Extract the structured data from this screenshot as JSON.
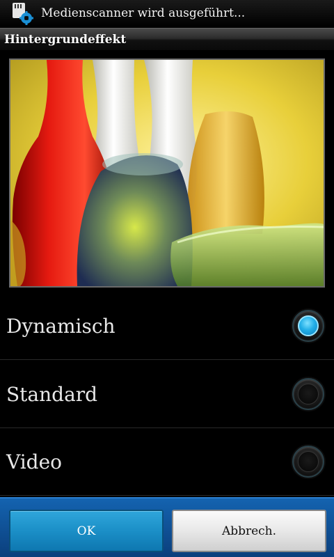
{
  "status_bar": {
    "notification_text": "Medienscanner wird ausgeführt...",
    "icon": "media-scanner-icon"
  },
  "dialog": {
    "title": "Hintergrundeffekt",
    "preview_icon": "glass-vases-image",
    "options": [
      {
        "label": "Dynamisch",
        "selected": true
      },
      {
        "label": "Standard",
        "selected": false
      },
      {
        "label": "Video",
        "selected": false
      }
    ],
    "buttons": {
      "ok": "OK",
      "cancel": "Abbrech."
    }
  },
  "colors": {
    "accent_blue": "#1b8fc7",
    "button_bar": "#1463b0",
    "background": "#000000"
  }
}
